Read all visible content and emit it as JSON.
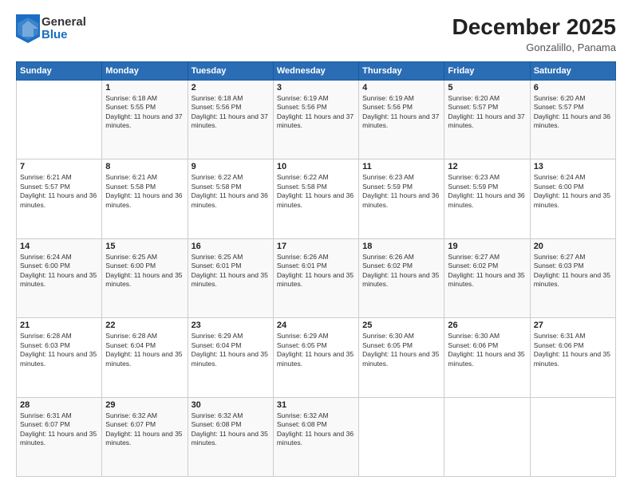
{
  "header": {
    "logo_general": "General",
    "logo_blue": "Blue",
    "main_title": "December 2025",
    "subtitle": "Gonzalillo, Panama"
  },
  "days_of_week": [
    "Sunday",
    "Monday",
    "Tuesday",
    "Wednesday",
    "Thursday",
    "Friday",
    "Saturday"
  ],
  "weeks": [
    [
      {
        "day": "",
        "info": ""
      },
      {
        "day": "1",
        "info": "Sunrise: 6:18 AM\nSunset: 5:55 PM\nDaylight: 11 hours and 37 minutes."
      },
      {
        "day": "2",
        "info": "Sunrise: 6:18 AM\nSunset: 5:56 PM\nDaylight: 11 hours and 37 minutes."
      },
      {
        "day": "3",
        "info": "Sunrise: 6:19 AM\nSunset: 5:56 PM\nDaylight: 11 hours and 37 minutes."
      },
      {
        "day": "4",
        "info": "Sunrise: 6:19 AM\nSunset: 5:56 PM\nDaylight: 11 hours and 37 minutes."
      },
      {
        "day": "5",
        "info": "Sunrise: 6:20 AM\nSunset: 5:57 PM\nDaylight: 11 hours and 37 minutes."
      },
      {
        "day": "6",
        "info": "Sunrise: 6:20 AM\nSunset: 5:57 PM\nDaylight: 11 hours and 36 minutes."
      }
    ],
    [
      {
        "day": "7",
        "info": "Sunrise: 6:21 AM\nSunset: 5:57 PM\nDaylight: 11 hours and 36 minutes."
      },
      {
        "day": "8",
        "info": "Sunrise: 6:21 AM\nSunset: 5:58 PM\nDaylight: 11 hours and 36 minutes."
      },
      {
        "day": "9",
        "info": "Sunrise: 6:22 AM\nSunset: 5:58 PM\nDaylight: 11 hours and 36 minutes."
      },
      {
        "day": "10",
        "info": "Sunrise: 6:22 AM\nSunset: 5:58 PM\nDaylight: 11 hours and 36 minutes."
      },
      {
        "day": "11",
        "info": "Sunrise: 6:23 AM\nSunset: 5:59 PM\nDaylight: 11 hours and 36 minutes."
      },
      {
        "day": "12",
        "info": "Sunrise: 6:23 AM\nSunset: 5:59 PM\nDaylight: 11 hours and 36 minutes."
      },
      {
        "day": "13",
        "info": "Sunrise: 6:24 AM\nSunset: 6:00 PM\nDaylight: 11 hours and 35 minutes."
      }
    ],
    [
      {
        "day": "14",
        "info": "Sunrise: 6:24 AM\nSunset: 6:00 PM\nDaylight: 11 hours and 35 minutes."
      },
      {
        "day": "15",
        "info": "Sunrise: 6:25 AM\nSunset: 6:00 PM\nDaylight: 11 hours and 35 minutes."
      },
      {
        "day": "16",
        "info": "Sunrise: 6:25 AM\nSunset: 6:01 PM\nDaylight: 11 hours and 35 minutes."
      },
      {
        "day": "17",
        "info": "Sunrise: 6:26 AM\nSunset: 6:01 PM\nDaylight: 11 hours and 35 minutes."
      },
      {
        "day": "18",
        "info": "Sunrise: 6:26 AM\nSunset: 6:02 PM\nDaylight: 11 hours and 35 minutes."
      },
      {
        "day": "19",
        "info": "Sunrise: 6:27 AM\nSunset: 6:02 PM\nDaylight: 11 hours and 35 minutes."
      },
      {
        "day": "20",
        "info": "Sunrise: 6:27 AM\nSunset: 6:03 PM\nDaylight: 11 hours and 35 minutes."
      }
    ],
    [
      {
        "day": "21",
        "info": "Sunrise: 6:28 AM\nSunset: 6:03 PM\nDaylight: 11 hours and 35 minutes."
      },
      {
        "day": "22",
        "info": "Sunrise: 6:28 AM\nSunset: 6:04 PM\nDaylight: 11 hours and 35 minutes."
      },
      {
        "day": "23",
        "info": "Sunrise: 6:29 AM\nSunset: 6:04 PM\nDaylight: 11 hours and 35 minutes."
      },
      {
        "day": "24",
        "info": "Sunrise: 6:29 AM\nSunset: 6:05 PM\nDaylight: 11 hours and 35 minutes."
      },
      {
        "day": "25",
        "info": "Sunrise: 6:30 AM\nSunset: 6:05 PM\nDaylight: 11 hours and 35 minutes."
      },
      {
        "day": "26",
        "info": "Sunrise: 6:30 AM\nSunset: 6:06 PM\nDaylight: 11 hours and 35 minutes."
      },
      {
        "day": "27",
        "info": "Sunrise: 6:31 AM\nSunset: 6:06 PM\nDaylight: 11 hours and 35 minutes."
      }
    ],
    [
      {
        "day": "28",
        "info": "Sunrise: 6:31 AM\nSunset: 6:07 PM\nDaylight: 11 hours and 35 minutes."
      },
      {
        "day": "29",
        "info": "Sunrise: 6:32 AM\nSunset: 6:07 PM\nDaylight: 11 hours and 35 minutes."
      },
      {
        "day": "30",
        "info": "Sunrise: 6:32 AM\nSunset: 6:08 PM\nDaylight: 11 hours and 35 minutes."
      },
      {
        "day": "31",
        "info": "Sunrise: 6:32 AM\nSunset: 6:08 PM\nDaylight: 11 hours and 36 minutes."
      },
      {
        "day": "",
        "info": ""
      },
      {
        "day": "",
        "info": ""
      },
      {
        "day": "",
        "info": ""
      }
    ]
  ]
}
